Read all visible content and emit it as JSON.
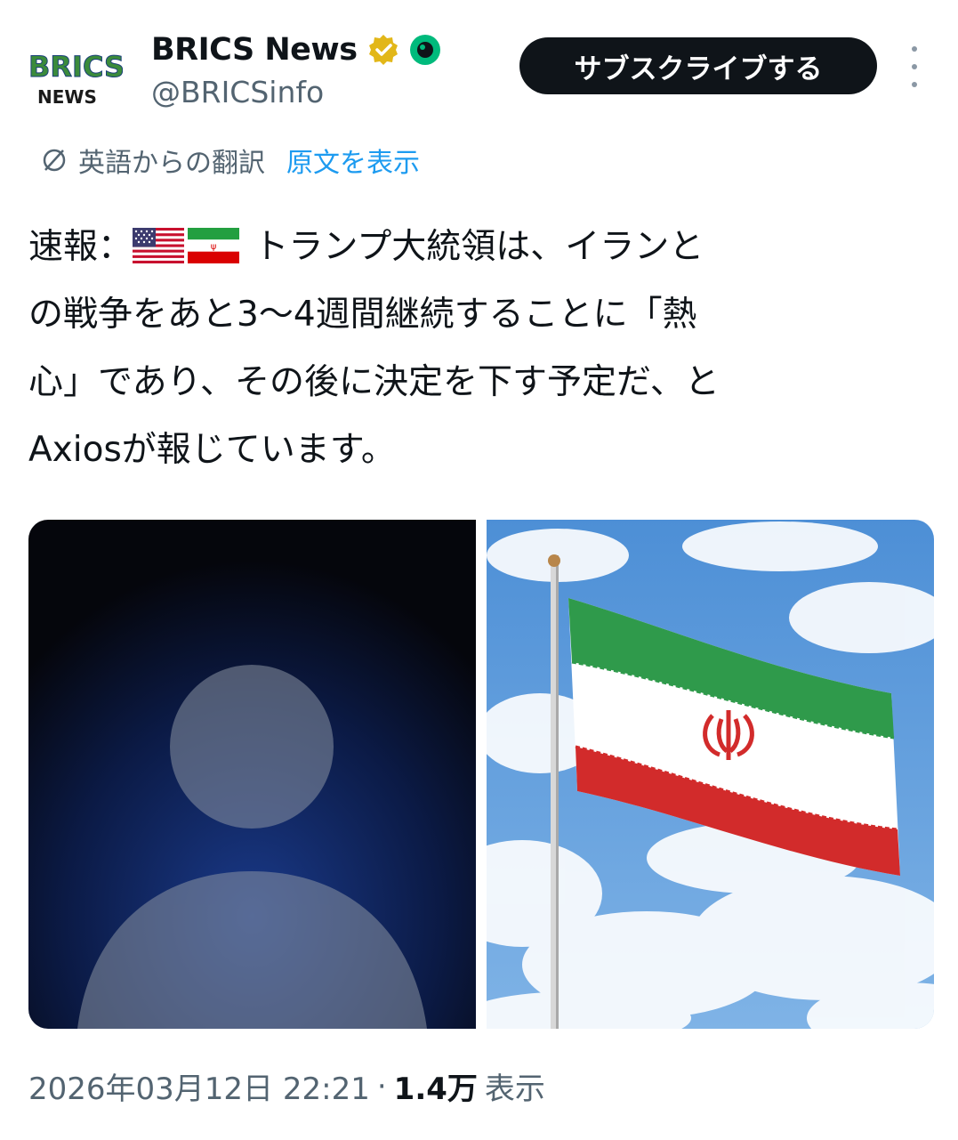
{
  "header": {
    "avatar_text_top": "BRICS",
    "avatar_text_bottom": "NEWS",
    "display_name": "BRICS News",
    "handle": "@BRICSinfo",
    "subscribe_label": "サブスクライブする",
    "verified_color": "#e2b719",
    "badge_color": "#00ba7c"
  },
  "translation": {
    "label": "英語からの翻訳",
    "link": "原文を表示"
  },
  "tweet": {
    "prefix": "速報：",
    "line1_rest": "トランプ大統領は、イランと",
    "line2": "の戦争をあと3〜4週間継続することに「熱",
    "line3": "心」であり、その後に決定を下す予定だ、と",
    "line4": "Axiosが報じています。"
  },
  "media": {
    "left_icon": "person-photo-icon",
    "right_icon": "iran-flag-icon"
  },
  "meta": {
    "timestamp": "2026年03月12日 22:21",
    "separator": "·",
    "views_count": "1.4万",
    "views_label": "表示"
  }
}
